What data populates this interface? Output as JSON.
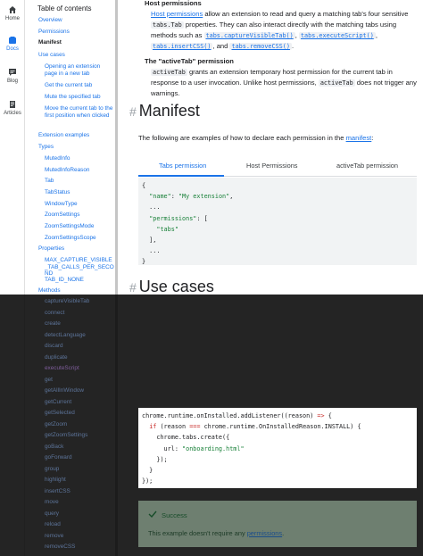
{
  "rail": {
    "items": [
      {
        "label": "Home",
        "icon": "home-icon"
      },
      {
        "label": "Docs",
        "icon": "docs-icon"
      },
      {
        "label": "Blog",
        "icon": "blog-icon"
      },
      {
        "label": "Articles",
        "icon": "articles-icon"
      }
    ],
    "active_color": "#1a73e8"
  },
  "toc": {
    "title": "Table of contents",
    "links": [
      "Overview",
      "Permissions",
      "Manifest",
      "Use cases",
      "Opening an extension page in a new tab",
      "Get the current tab",
      "Mute the specified tab",
      "Move the current tab to the first position when clicked",
      "Extension examples",
      "Types",
      "MutedInfo",
      "MutedInfoReason",
      "Tab",
      "TabStatus",
      "WindowType",
      "ZoomSettings",
      "ZoomSettingsMode",
      "ZoomSettingsScope",
      "Properties",
      "MAX_CAPTURE_VISIBLE_TAB_CALLS_PER_SECOND",
      "TAB_ID_NONE",
      "Methods"
    ],
    "methods": [
      "captureVisibleTab",
      "connect",
      "create",
      "detectLanguage",
      "discard",
      "duplicate",
      "executeScript",
      "get",
      "getAllInWindow",
      "getCurrent",
      "getSelected",
      "getZoom",
      "getZoomSettings",
      "goBack",
      "goForward",
      "group",
      "highlight",
      "insertCSS",
      "move",
      "query",
      "reload",
      "remove",
      "removeCSS"
    ]
  },
  "main": {
    "host_heading": "Host permissions",
    "host_link": "Host permissions",
    "host_text1": " allow an extension to read and query a matching tab's four sensitive ",
    "host_code1": "tabs.Tab",
    "host_text2": " properties. They can also interact directly with the matching tabs using methods such as ",
    "host_methods": [
      "tabs.captureVisibleTab()",
      "tabs.executeScript()",
      "tabs.insertCSS()",
      "tabs.removeCSS()"
    ],
    "active_heading": "The \"activeTab\" permission",
    "active_code": "activeTab",
    "active_text1": " grants an extension temporary host permission for the current tab in response to a user invocation. Unlike host permissions, ",
    "active_code2": "activeTab",
    "active_text2": " does not trigger any warnings.",
    "manifest_heading": "Manifest",
    "manifest_text": "The following are examples of how to declare each permission in the ",
    "manifest_link": "manifest",
    "tabs": [
      "Tabs permission",
      "Host Permissions",
      "activeTab permission"
    ],
    "code_lines": [
      "{",
      "  \"name\": \"My extension\",",
      "  ...",
      "  \"permissions\": [",
      "    \"tabs\"",
      "  ],",
      "  ...",
      "}"
    ],
    "usecases_heading": "Use cases",
    "code2_lines": [
      "chrome.runtime.onInstalled.addListener((reason) => {",
      "  if (reason === chrome.runtime.OnInstalledReason.INSTALL) {",
      "    chrome.tabs.create({",
      "      url: \"onboarding.html\"",
      "    });",
      "  }",
      "});"
    ],
    "success_title": "Success",
    "success_text": "This example doesn't require any ",
    "success_link": "permissions",
    "success_end": "."
  }
}
